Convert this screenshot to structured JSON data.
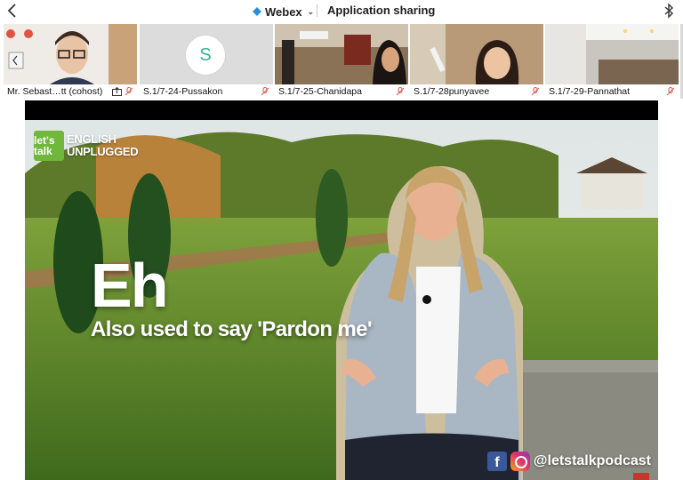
{
  "topbar": {
    "app_name": "Webex",
    "title": "Application sharing"
  },
  "participants": [
    {
      "name": "Mr. Sebast…tt (cohost)",
      "muted": true,
      "sharing": true
    },
    {
      "name": "S.1/7-24-Pussakon",
      "initial": "S",
      "muted": true
    },
    {
      "name": "S.1/7-25-Chanidapa",
      "muted": true
    },
    {
      "name": "S.1/7-28punyavee",
      "muted": true
    },
    {
      "name": "S.1/7-29-Pannathat",
      "muted": true
    }
  ],
  "video": {
    "logo_badge": "let's talk",
    "logo_line1": "ENGLISH",
    "logo_line2": "UNPLUGGED",
    "headword": "Eh",
    "subline": "Also used to say 'Pardon me'",
    "handle": "@letstalkpodcast",
    "fb_letter": "f"
  },
  "colors": {
    "webex_accent": "#2a8fd6",
    "mute_red": "#d9534f",
    "avatar_green": "#34b493",
    "logo_green": "#6fb83c"
  },
  "icons": {
    "back": "chevron-left-icon",
    "app": "webex-icon",
    "bluetooth": "bluetooth-icon",
    "mute": "mic-muted-icon",
    "share": "share-screen-icon"
  }
}
